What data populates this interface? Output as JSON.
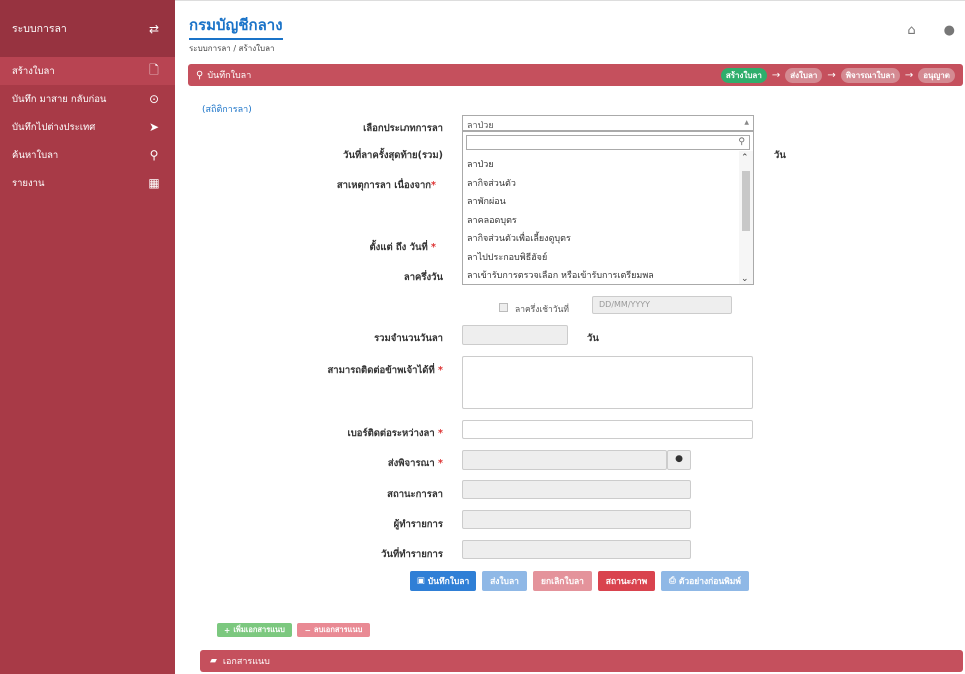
{
  "sidebar": {
    "title": "ระบบการลา",
    "title_icon": "exchange-icon",
    "items": [
      {
        "label": "สร้างใบลา",
        "icon": "file-icon"
      },
      {
        "label": "บันทึก มาสาย กลับก่อน",
        "icon": "clock-icon"
      },
      {
        "label": "บันทึกไปต่างประเทศ",
        "icon": "plane-icon"
      },
      {
        "label": "ค้นหาใบลา",
        "icon": "search-icon"
      },
      {
        "label": "รายงาน",
        "icon": "table-icon"
      }
    ]
  },
  "header": {
    "brand": "กรมบัญชีกลาง",
    "breadcrumb": "ระบบการลา / สร้างใบลา"
  },
  "panel": {
    "title": "บันทึกใบลา",
    "steps": [
      "สร้างใบลา",
      "ส่งใบลา",
      "พิจารณาใบลา",
      "อนุญาต"
    ]
  },
  "stat_link": "(สถิติการลา)",
  "form": {
    "leave_type_label": "เลือกประเภทการลา",
    "leave_type_value": "ลาป่วย",
    "last_leave_label": "วันที่ลาครั้งสุดท้าย(รวม)",
    "day_unit": "วัน",
    "reason_label": "สาเหตุการลา เนื่องจาก",
    "from_to_label": "ตั้งแต่ ถึง วันที่",
    "half_day_label": "ลาครึ่งวัน",
    "half_day_morning_label": "ลาครึ่งเช้าวันที่",
    "date_placeholder": "DD/MM/YYYY",
    "total_days_label": "รวมจำนวนวันลา",
    "total_unit": "วัน",
    "contact_label": "สามารถติดต่อข้าพเจ้าได้ที่",
    "phone_label": "เบอร์ติดต่อระหว่างลา",
    "send_to_label": "ส่งพิจารณา",
    "status_label": "สถานะการลา",
    "creator_label": "ผู้ทำรายการ",
    "created_date_label": "วันที่ทำรายการ"
  },
  "dropdown_options": [
    "ลาป่วย",
    "ลากิจส่วนตัว",
    "ลาพักผ่อน",
    "ลาคลอดบุตร",
    "ลากิจส่วนตัวเพื่อเลี้ยงดูบุตร",
    "ลาไปประกอบพิธีฮัจย์",
    "ลาเข้ารับการตรวจเลือก หรือเข้ารับการเตรียมพล"
  ],
  "buttons": {
    "save": "บันทึกใบลา",
    "send": "ส่งใบลา",
    "cancel": "ยกเลิกใบลา",
    "status": "สถานะภาพ",
    "preview": "ตัวอย่างก่อนพิมพ์",
    "add_doc": "เพิ่มเอกสารแนบ",
    "remove_doc": "ลบเอกสารแนบ"
  },
  "attachments_title": "เอกสารแนบ"
}
